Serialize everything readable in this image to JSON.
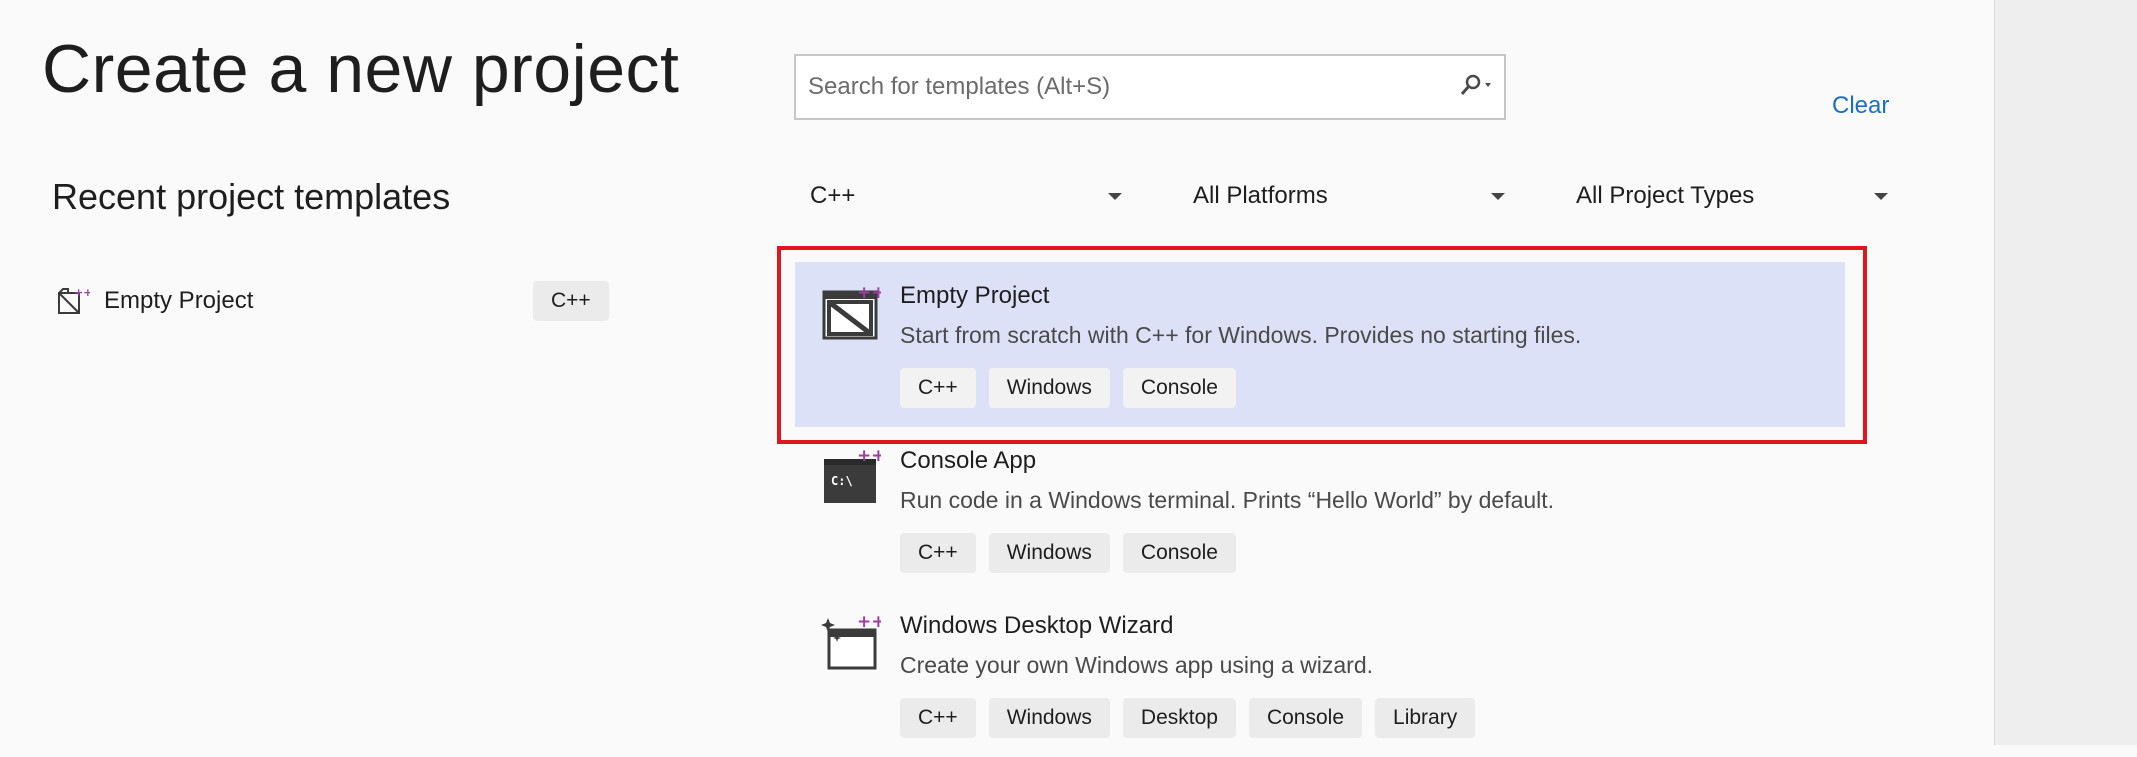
{
  "header": {
    "title": "Create a new project"
  },
  "recent": {
    "title": "Recent project templates",
    "items": [
      {
        "label": "Empty Project",
        "tag": "C++",
        "icon": "empty-project-icon"
      }
    ]
  },
  "search": {
    "placeholder": "Search for templates (Alt+S)",
    "value": "",
    "icon": "search-icon"
  },
  "clear_label": "Clear",
  "filters": {
    "language": "C++",
    "platform": "All Platforms",
    "project_type": "All Project Types"
  },
  "templates": [
    {
      "name": "Empty Project",
      "description": "Start from scratch with C++ for Windows. Provides no starting files.",
      "tags": [
        "C++",
        "Windows",
        "Console"
      ],
      "icon": "empty-project-icon",
      "selected": true
    },
    {
      "name": "Console App",
      "description": "Run code in a Windows terminal. Prints “Hello World” by default.",
      "tags": [
        "C++",
        "Windows",
        "Console"
      ],
      "icon": "console-app-icon",
      "selected": false
    },
    {
      "name": "Windows Desktop Wizard",
      "description": "Create your own Windows app using a wizard.",
      "tags": [
        "C++",
        "Windows",
        "Desktop",
        "Console",
        "Library"
      ],
      "icon": "desktop-wizard-icon",
      "selected": false
    }
  ],
  "colors": {
    "accent_link": "#1a6fc4",
    "selection_bg": "#dde1f7",
    "highlight_border": "#e0161e",
    "cpp_badge": "#9b3fa0"
  }
}
